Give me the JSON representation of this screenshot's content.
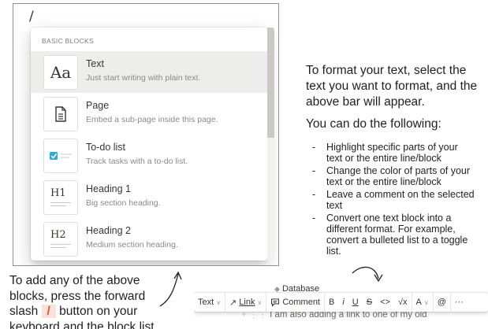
{
  "editor": {
    "typed_slash": "/"
  },
  "menu": {
    "section_label": "BASIC BLOCKS",
    "items": [
      {
        "title": "Text",
        "description": "Just start writing with plain text.",
        "icon": "text-aa-icon",
        "thumb": "Aa",
        "selected": true
      },
      {
        "title": "Page",
        "description": "Embed a sub-page inside this page.",
        "icon": "page-icon"
      },
      {
        "title": "To-do list",
        "description": "Track tasks with a to-do list.",
        "icon": "todo-checkbox-icon"
      },
      {
        "title": "Heading 1",
        "description": "Big section heading.",
        "icon": "heading-1-icon",
        "thumb": "H1"
      },
      {
        "title": "Heading 2",
        "description": "Medium section heading.",
        "icon": "heading-2-icon",
        "thumb": "H2"
      }
    ]
  },
  "instructions": {
    "para_lines": [
      "To format your text, select the",
      "text you want to format, and the",
      "above bar will appear."
    ],
    "subheading": "You can do the following:",
    "bullets": [
      [
        "Highlight specific parts of your",
        "text or the entire line/block"
      ],
      [
        "Change the color of parts of your",
        "text or the entire line/block"
      ],
      [
        "Leave a comment on the selected",
        "text"
      ],
      [
        "Convert one text block into a",
        "different format. For example,",
        "convert a bulleted list to a toggle",
        "list."
      ]
    ]
  },
  "bottom_note": {
    "line1": "To add any of the above",
    "line2": "blocks, press the forward",
    "line3_pre": "slash",
    "line3_key": "/",
    "line3_post": "button on your",
    "line4": "keyboard and the block list"
  },
  "toolbar": {
    "background_title": "Database",
    "background_text": "I am also adding a link to one of my old",
    "text_label": "Text",
    "link_label": "Link",
    "comment_label": "Comment",
    "bold": "B",
    "italic": "i",
    "underline": "U",
    "strike": "S",
    "code": "<>",
    "equation": "√x",
    "color": "A",
    "mention": "@",
    "more": "···"
  },
  "colors": {
    "accent": "#2eaadc",
    "slash_chip_bg": "#fbe1da",
    "slash_chip_text": "#d9572f"
  }
}
